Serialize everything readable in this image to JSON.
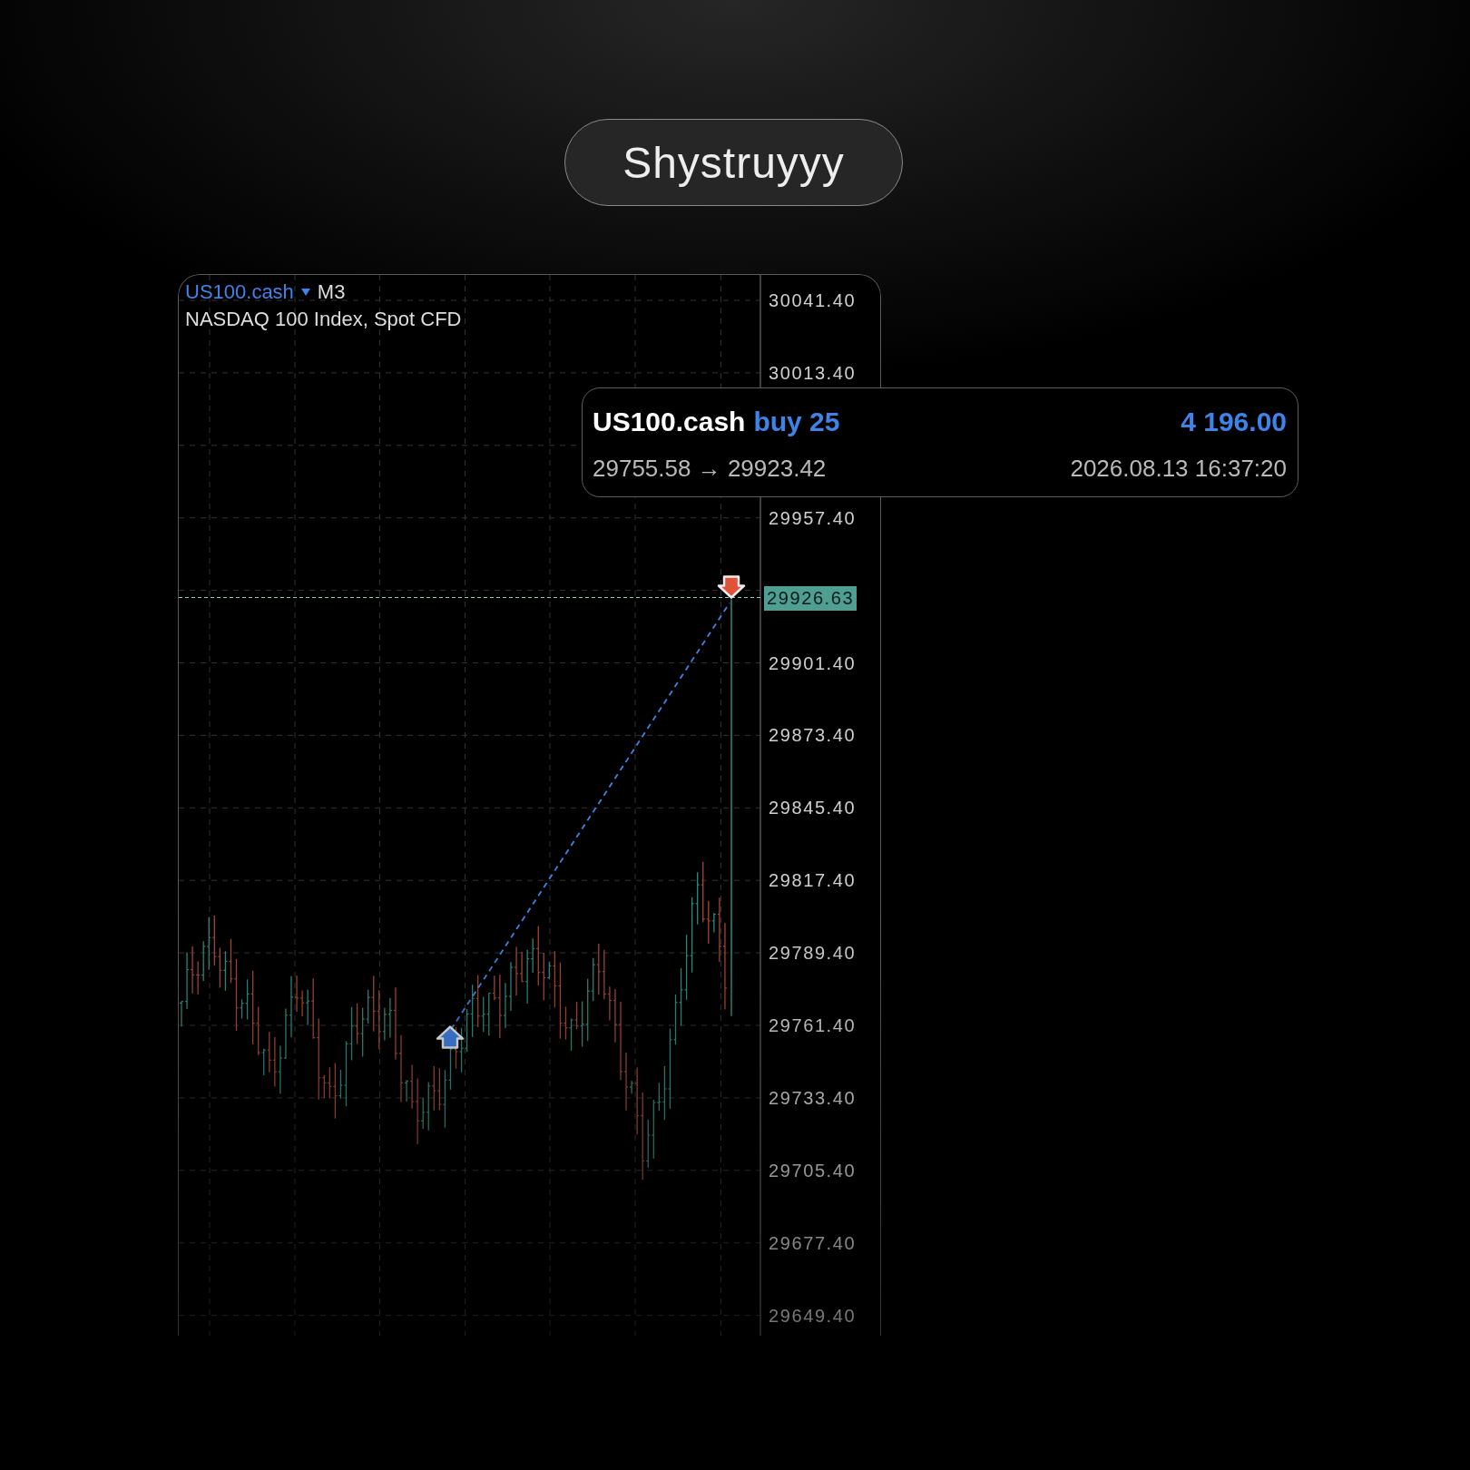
{
  "title_pill": {
    "label": "Shystruyyy"
  },
  "chart": {
    "symbol": "US100.cash",
    "timeframe": "M3",
    "description": "NASDAQ 100 Index, Spot CFD",
    "current_price": "29926.63",
    "price_labels": [
      "30041.40",
      "30013.40",
      "29957.40",
      "29901.40",
      "29873.40",
      "29845.40",
      "29817.40",
      "29789.40",
      "29761.40",
      "29733.40",
      "29705.40",
      "29677.40",
      "29649.40"
    ]
  },
  "trade_tooltip": {
    "symbol": "US100.cash",
    "side": "buy 25",
    "profit": "4 196.00",
    "prices": "29755.58 → 29923.42",
    "time": "2026.08.13 16:37:20"
  }
}
